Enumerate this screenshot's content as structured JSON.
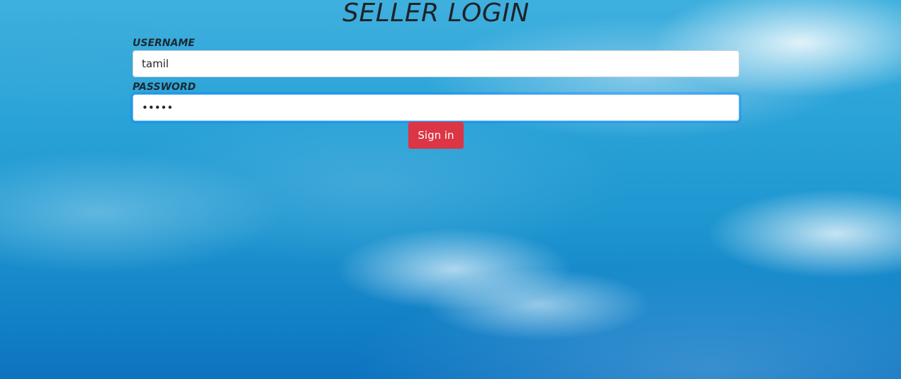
{
  "page": {
    "title": "SELLER LOGIN",
    "background": "sky-clouds-image"
  },
  "form": {
    "username": {
      "label": "USERNAME",
      "value": "tamil"
    },
    "password": {
      "label": "PASSWORD",
      "value": "tamil",
      "focused": true
    },
    "submit": {
      "label": "Sign in",
      "color": "#dc3545"
    }
  },
  "colors": {
    "title": "#1f2328",
    "focus_ring": "#80bdff"
  }
}
